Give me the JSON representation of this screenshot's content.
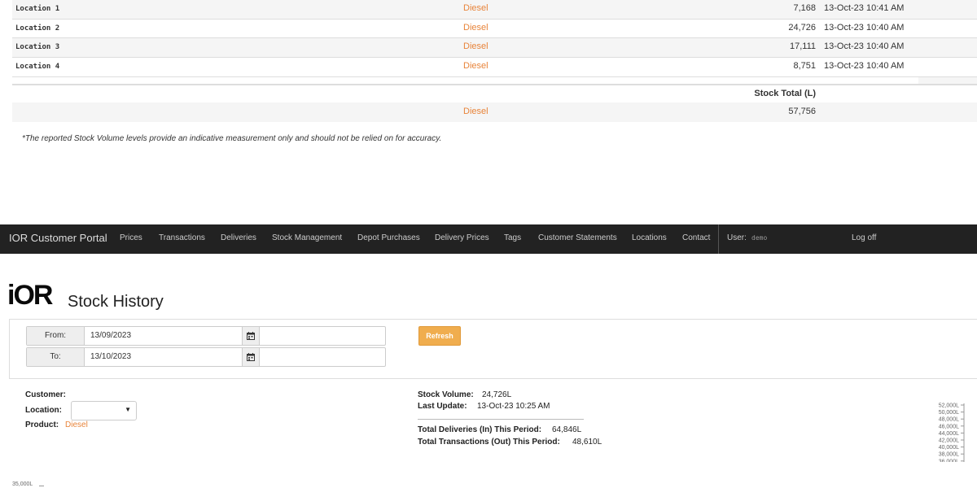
{
  "stock_table": {
    "rows": [
      {
        "location": "Location 1",
        "product": "Diesel",
        "volume": "7,168",
        "updated": "13-Oct-23 10:41 AM"
      },
      {
        "location": "Location 2",
        "product": "Diesel",
        "volume": "24,726",
        "updated": "13-Oct-23 10:40 AM"
      },
      {
        "location": "Location 3",
        "product": "Diesel",
        "volume": "17,111",
        "updated": "13-Oct-23 10:40 AM"
      },
      {
        "location": "Location 4",
        "product": "Diesel",
        "volume": "8,751",
        "updated": "13-Oct-23 10:40 AM"
      }
    ],
    "total_header": "Stock Total (L)",
    "total_product": "Diesel",
    "total_volume": "57,756",
    "disclaimer": "*The reported Stock Volume levels provide an indicative measurement only and should not be relied on for accuracy."
  },
  "navbar": {
    "brand": "IOR Customer Portal",
    "items": [
      "Prices",
      "Transactions",
      "Deliveries",
      "Stock Management",
      "Depot Purchases",
      "Delivery Prices",
      "Tags",
      "Customer Statements",
      "Locations",
      "Contact"
    ],
    "user_label": "User:",
    "user_name": "demo",
    "logoff": "Log off"
  },
  "page": {
    "logo": "iOR",
    "title": "Stock History"
  },
  "filter": {
    "from_label": "From:",
    "from_value": "13/09/2023",
    "to_label": "To:",
    "to_value": "13/10/2023",
    "refresh_label": "Refresh"
  },
  "info": {
    "customer_label": "Customer:",
    "location_label": "Location:",
    "location_value": "",
    "product_label": "Product:",
    "product_value": "Diesel",
    "stock_volume_label": "Stock Volume:",
    "stock_volume_value": "24,726L",
    "last_update_label": "Last Update:",
    "last_update_value": "13-Oct-23 10:25 AM",
    "deliveries_label": "Total Deliveries (In) This Period:",
    "deliveries_value": "64,846L",
    "transactions_label": "Total Transactions (Out) This Period:",
    "transactions_value": "48,610L"
  },
  "chart_data": {
    "type": "line",
    "y_ticks": [
      "52,000L",
      "50,000L",
      "48,000L",
      "46,000L",
      "44,000L",
      "42,000L",
      "40,000L",
      "38,000L",
      "36,000L"
    ],
    "ylim": [
      36000,
      52000
    ],
    "bottom_tick": "35,000L"
  },
  "colors": {
    "accent": "#e8843a",
    "navbar": "#222222",
    "button": "#f0ad4e"
  }
}
